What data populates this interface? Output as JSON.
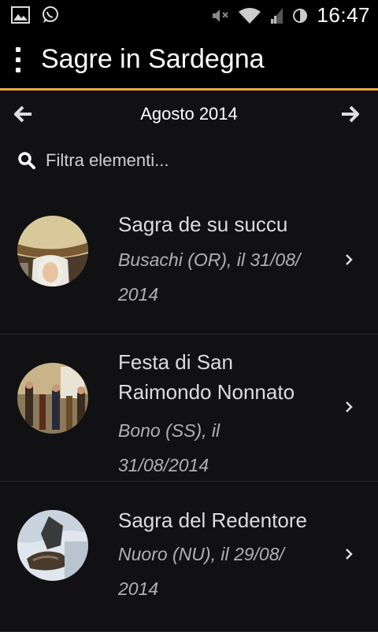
{
  "status_bar": {
    "time": "16:47",
    "left_icons": [
      "image-icon",
      "whatsapp-icon"
    ],
    "right_icons": [
      "mute-icon",
      "wifi-icon",
      "signal-icon",
      "sync-icon"
    ]
  },
  "app_bar": {
    "title": "Sagre in Sardegna",
    "accent_color": "#e8a84a"
  },
  "month_nav": {
    "label": "Agosto 2014",
    "prev_icon": "arrow-left-icon",
    "next_icon": "arrow-right-icon"
  },
  "search": {
    "placeholder": "Filtra elementi..."
  },
  "events": [
    {
      "title_lines": [
        "Sagra de su succu"
      ],
      "subtitle_lines": [
        "Busachi (OR), il 31/08/",
        "2014"
      ]
    },
    {
      "title_lines": [
        "Festa di San",
        "Raimondo Nonnato"
      ],
      "subtitle_lines": [
        "Bono (SS), il 31/08/2014"
      ]
    },
    {
      "title_lines": [
        "Sagra del Redentore"
      ],
      "subtitle_lines": [
        "Nuoro (NU), il 29/08/",
        "2014"
      ]
    }
  ]
}
